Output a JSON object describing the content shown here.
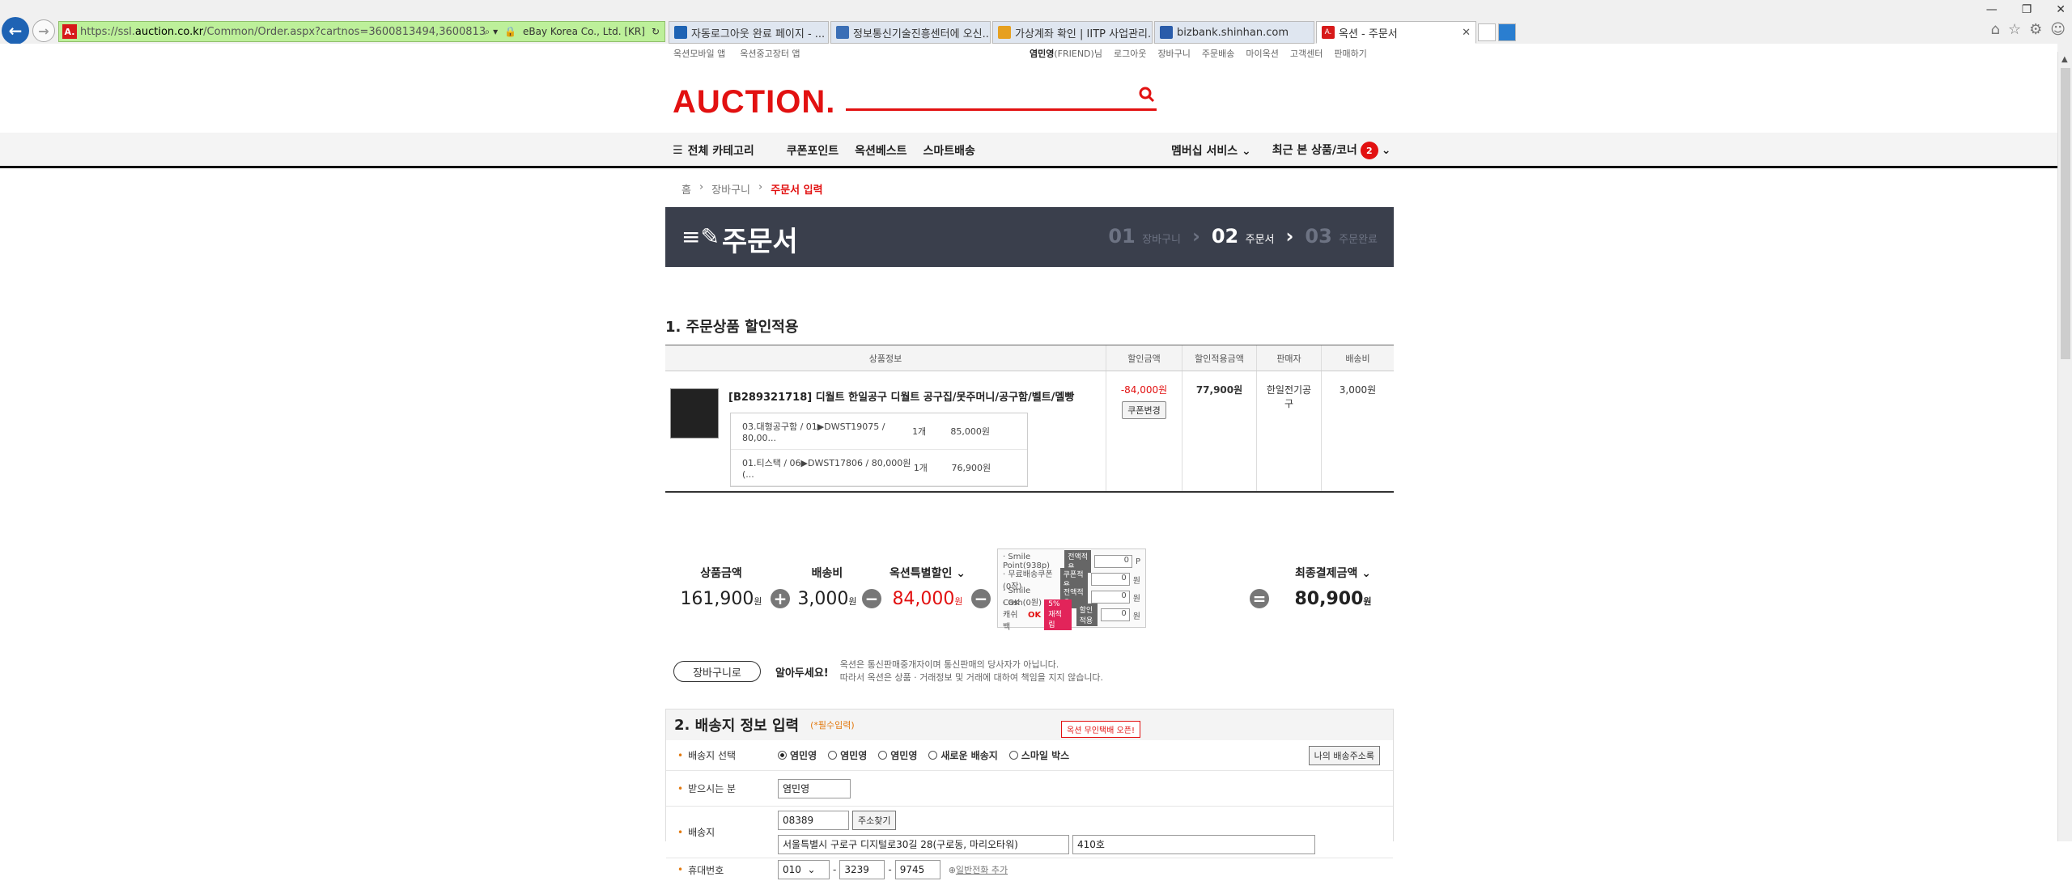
{
  "browser": {
    "url_prefix": "https://ssl.",
    "url_host": "auction.co.kr",
    "url_path": "/Common/Order.aspx?cartnos=3600813494,3600813499",
    "cert": "eBay Korea Co., Ltd. [KR]",
    "tabs": [
      {
        "label": "자동로그아웃 완료 페이지 - ...",
        "icon_color": "#1e63b4"
      },
      {
        "label": "정보통신기술진흥센터에 오신...",
        "icon_color": "#3b6fb6"
      },
      {
        "label": "가상계좌 확인 | IITP 사업관리...",
        "icon_color": "#e6a020"
      },
      {
        "label": "bizbank.shinhan.com",
        "icon_color": "#2a5caa"
      },
      {
        "label": "옥션 - 주문서",
        "icon_color": "#d71a1a"
      }
    ]
  },
  "util": {
    "left": [
      "옥션모바일 앱",
      "옥션중고장터 앱"
    ],
    "user": "염민영",
    "user_suffix": "(FRIEND)님",
    "right": [
      "로그아웃",
      "장바구니",
      "주문배송",
      "마이옥션",
      "고객센터",
      "판매하기"
    ]
  },
  "logo": "AUCTION.",
  "gnb": {
    "category": "전체 카테고리",
    "links": [
      "쿠폰포인트",
      "옥션베스트",
      "스마트배송"
    ],
    "membership": "멤버십 서비스",
    "recent": "최근 본 상품/코너",
    "recent_count": "2"
  },
  "breadcrumb": [
    "홈",
    "장바구니",
    "주문서 입력"
  ],
  "header": {
    "title": "주문서",
    "steps": [
      {
        "num": "01",
        "label": "장바구니"
      },
      {
        "num": "02",
        "label": "주문서"
      },
      {
        "num": "03",
        "label": "주문완료"
      }
    ]
  },
  "section1": {
    "title": "1. 주문상품 할인적용",
    "columns": [
      "상품정보",
      "할인금액",
      "할인적용금액",
      "판매자",
      "배송비"
    ],
    "product": {
      "name": "[B289321718] 디월트 한일공구 디월트 공구집/못주머니/공구함/벨트/멜빵",
      "options": [
        {
          "name": "03.대형공구함 / 01▶DWST19075 / 80,00...",
          "qty": "1개",
          "price": "85,000원"
        },
        {
          "name": "01.티스택 / 06▶DWST17806 / 80,000원 (...",
          "qty": "1개",
          "price": "76,900원"
        }
      ],
      "discount": "-84,000원",
      "coupon_btn": "쿠폰변경",
      "applied": "77,900원",
      "seller": "한일전기공구",
      "shipping": "3,000원"
    }
  },
  "summary": {
    "goods_label": "상품금액",
    "goods": "161,900",
    "ship_label": "배송비",
    "ship": "3,000",
    "special_label": "옥션특별할인",
    "special": "84,000",
    "won": "원",
    "points": [
      {
        "label": "· Smile Point(938p)",
        "btn": "전액적용",
        "val": "0",
        "unit": "P"
      },
      {
        "label": "· 무료배송쿠폰(0장)",
        "btn": "쿠폰적용",
        "val": "0",
        "unit": "원"
      },
      {
        "label": "· Smile Cash(0원)",
        "btn": "전액적용",
        "val": "0",
        "unit": "원"
      },
      {
        "label": "· OK캐쉬백",
        "btn": "할인적용",
        "val": "0",
        "unit": "원"
      }
    ],
    "ok_badge": "5% 재적립",
    "final_label": "최종결제금액",
    "final": "80,900"
  },
  "notice": {
    "cart_btn": "장바구니로",
    "head": "알아두세요!",
    "line1": "옥션은 통신판매중개자이며 통신판매의 당사자가 아닙니다.",
    "line2": "따라서 옥션은 상품 · 거래정보 및 거래에 대하여 책임을 지지 않습니다."
  },
  "section2": {
    "num": "2.",
    "title": "배송지 정보 입력",
    "required": "(*필수입력)",
    "tip": "옥션 무인택배 오픈!",
    "select_label": "배송지 선택",
    "choices": [
      "염민영",
      "염민영",
      "염민영",
      "새로운 배송지",
      "스마일 박스"
    ],
    "my_addr": "나의 배송주소록",
    "recipient_label": "받으시는 분",
    "recipient": "염민영",
    "address_label": "배송지",
    "zip": "08389",
    "zip_btn": "주소찾기",
    "addr1": "서울특별시 구로구 디지털로30길 28(구로동, 마리오타워)",
    "addr2": "410호",
    "phone_label": "휴대번호",
    "phone": [
      "010",
      "3239",
      "9745"
    ],
    "add_phone": "일반전화 추가"
  }
}
